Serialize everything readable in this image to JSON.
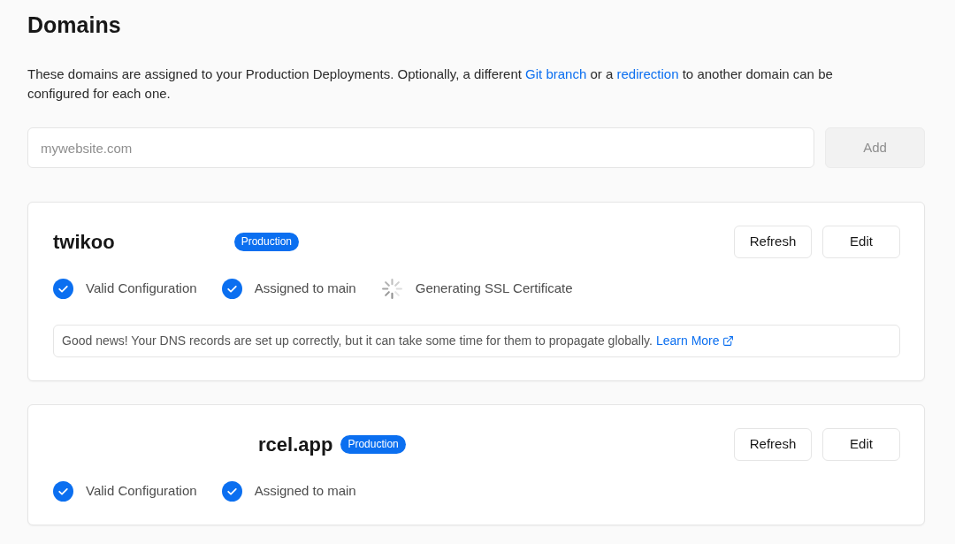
{
  "page": {
    "title": "Domains",
    "description": [
      {
        "kind": "text",
        "text": "These domains are assigned to your Production Deployments. Optionally, a different "
      },
      {
        "kind": "link",
        "text": "Git branch"
      },
      {
        "kind": "text",
        "text": " or a "
      },
      {
        "kind": "link",
        "text": "redirection"
      },
      {
        "kind": "text",
        "text": " to another domain can be configured for each one."
      }
    ]
  },
  "add_form": {
    "placeholder": "mywebsite.com",
    "button": {
      "label": "Add",
      "disabled": true
    }
  },
  "domains": [
    {
      "kind": "masked_end",
      "name": "twikoo",
      "badge": "Production",
      "buttons": [
        "Refresh",
        "Edit"
      ],
      "statuses": [
        {
          "kind": "check",
          "label": "Valid Configuration"
        },
        {
          "kind": "check",
          "label": "Assigned to main"
        },
        {
          "kind": "spinner",
          "label": "Generating SSL Certificate"
        }
      ],
      "note": {
        "text": "Good news! Your DNS records are set up correctly, but it can take some time for them to propagate globally.",
        "link": "Learn More"
      }
    },
    {
      "kind": "masked_start",
      "name": "rcel.app",
      "badge": "Production",
      "buttons": [
        "Refresh",
        "Edit"
      ],
      "statuses": [
        {
          "kind": "check",
          "label": "Valid Configuration"
        },
        {
          "kind": "check",
          "label": "Assigned to main"
        }
      ]
    }
  ]
}
